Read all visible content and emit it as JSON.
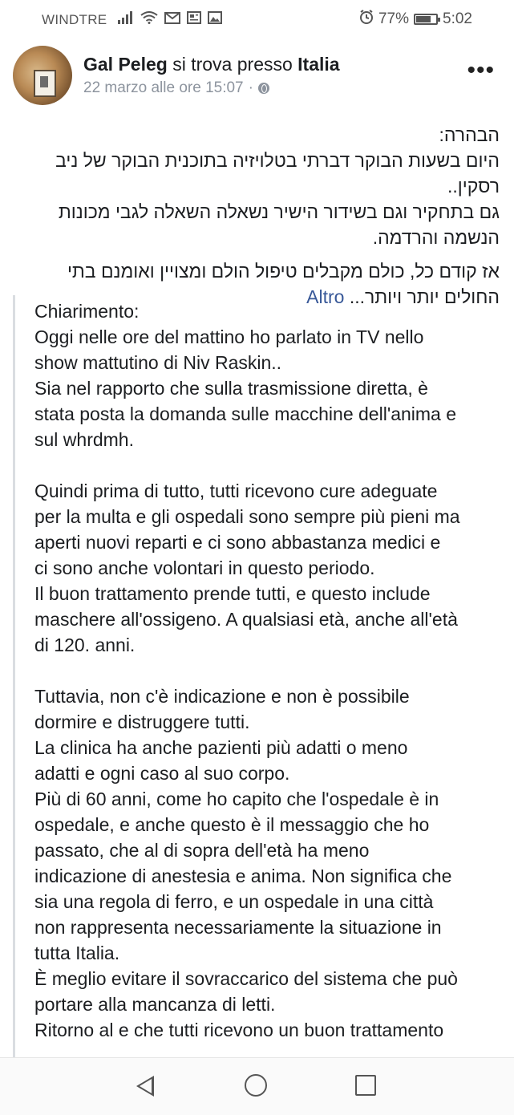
{
  "status_bar": {
    "carrier": "WINDTRE",
    "battery": "77%",
    "battery_level": 0.77,
    "time": "5:02",
    "icons": [
      "signal-icon",
      "wifi-icon",
      "mail-icon",
      "news-icon",
      "gallery-icon",
      "alarm-icon",
      "battery-icon"
    ]
  },
  "post": {
    "author": "Gal Peleg",
    "location_prefix": "si trova presso",
    "location": "Italia",
    "timestamp": "22 marzo alle ore 15:07",
    "separator": "·",
    "more_menu": "•••"
  },
  "hebrew": {
    "p1_l1": "הבהרה:",
    "p1_l2": "היום בשעות הבוקר דברתי בטלויזיה בתוכנית הבוקר של ניב",
    "p1_l3": "רסקין..",
    "p1_l4": "גם בתחקיר וגם בשידור הישיר נשאלה השאלה לגבי מכונות",
    "p1_l5": "הנשמה והרדמה.",
    "p2": "אז קודם כל, כולם מקבלים טיפול הולם ומצויין ואומנם בתי החולים יותר ויותר...",
    "more_label": "Altro"
  },
  "translation": {
    "lines": [
      "Chiarimento:",
      "Oggi nelle ore del mattino ho parlato in TV nello",
      "show mattutino di Niv Raskin..",
      "Sia nel rapporto che sulla trasmissione diretta, è",
      "stata posta la domanda sulle macchine dell'anima e",
      "sul whrdmh.",
      "",
      "Quindi prima di tutto, tutti ricevono cure adeguate",
      "per la multa e gli ospedali sono sempre più pieni ma",
      "aperti nuovi reparti e ci sono abbastanza medici e",
      "ci sono anche volontari in questo periodo.",
      "Il buon trattamento prende tutti, e questo include",
      "maschere all'ossigeno. A qualsiasi età, anche all'età",
      "di 120. anni.",
      "",
      "Tuttavia, non c'è indicazione e non è possibile",
      "dormire e distruggere tutti.",
      "La clinica ha anche pazienti più adatti o meno",
      "adatti e ogni caso al suo corpo.",
      "Più di 60 anni, come ho capito che l'ospedale è in",
      "ospedale, e anche questo è il messaggio che ho",
      "passato, che al di sopra dell'età ha meno",
      "indicazione di anestesia e anima. Non significa che",
      "sia una regola di ferro, e un ospedale in una città",
      "non rappresenta necessariamente la situazione in",
      "tutta Italia.",
      "È meglio evitare il sovraccarico del sistema che può",
      "portare alla mancanza di letti.",
      "Ritorno al e che tutti ricevono un buon trattamento"
    ]
  },
  "nav": {
    "icons": [
      "back-icon",
      "home-icon",
      "recent-apps-icon"
    ]
  }
}
